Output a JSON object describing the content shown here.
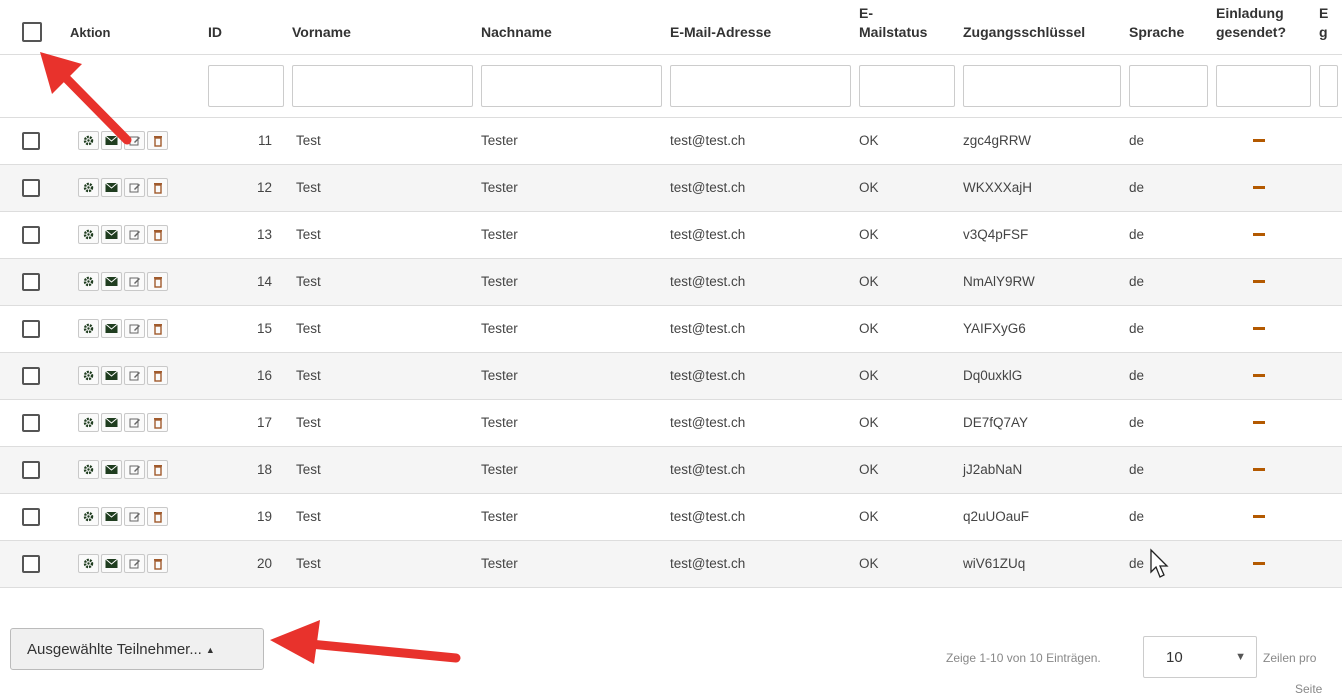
{
  "columns": {
    "action": "Aktion",
    "id": "ID",
    "first_name": "Vorname",
    "last_name": "Nachname",
    "email": "E-Mail-Adresse",
    "email_status_line1": "E-",
    "email_status_line2": "Mailstatus",
    "access_key": "Zugangsschlüssel",
    "language": "Sprache",
    "invitation_line1": "Einladung",
    "invitation_line2": "gesendet?",
    "next_line1": "E",
    "next_line2": "g"
  },
  "action_icons": [
    "gear-icon",
    "envelope-icon",
    "edit-icon",
    "trash-icon"
  ],
  "rows": [
    {
      "id": "11",
      "first_name": "Test",
      "last_name": "Tester",
      "email": "test@test.ch",
      "email_status": "OK",
      "access_key": "zgc4gRRW",
      "language": "de"
    },
    {
      "id": "12",
      "first_name": "Test",
      "last_name": "Tester",
      "email": "test@test.ch",
      "email_status": "OK",
      "access_key": "WKXXXajH",
      "language": "de"
    },
    {
      "id": "13",
      "first_name": "Test",
      "last_name": "Tester",
      "email": "test@test.ch",
      "email_status": "OK",
      "access_key": "v3Q4pFSF",
      "language": "de"
    },
    {
      "id": "14",
      "first_name": "Test",
      "last_name": "Tester",
      "email": "test@test.ch",
      "email_status": "OK",
      "access_key": "NmAlY9RW",
      "language": "de"
    },
    {
      "id": "15",
      "first_name": "Test",
      "last_name": "Tester",
      "email": "test@test.ch",
      "email_status": "OK",
      "access_key": "YAIFXyG6",
      "language": "de"
    },
    {
      "id": "16",
      "first_name": "Test",
      "last_name": "Tester",
      "email": "test@test.ch",
      "email_status": "OK",
      "access_key": "Dq0uxklG",
      "language": "de"
    },
    {
      "id": "17",
      "first_name": "Test",
      "last_name": "Tester",
      "email": "test@test.ch",
      "email_status": "OK",
      "access_key": "DE7fQ7AY",
      "language": "de"
    },
    {
      "id": "18",
      "first_name": "Test",
      "last_name": "Tester",
      "email": "test@test.ch",
      "email_status": "OK",
      "access_key": "jJ2abNaN",
      "language": "de"
    },
    {
      "id": "19",
      "first_name": "Test",
      "last_name": "Tester",
      "email": "test@test.ch",
      "email_status": "OK",
      "access_key": "q2uUOauF",
      "language": "de"
    },
    {
      "id": "20",
      "first_name": "Test",
      "last_name": "Tester",
      "email": "test@test.ch",
      "email_status": "OK",
      "access_key": "wiV61ZUq",
      "language": "de"
    }
  ],
  "footer": {
    "bulk_button_label": "Ausgewählte Teilnehmer...",
    "pager_info": "Zeige 1-10 von 10 Einträgen.",
    "page_size": "10",
    "rows_label_line1": "Zeilen pro",
    "rows_label_line2": "Seite"
  },
  "colors": {
    "annotation_arrow": "#e8322c",
    "invitation_dash": "#b35900",
    "action_icon": "#1f3d1f",
    "delete_icon": "#a05a2c"
  }
}
